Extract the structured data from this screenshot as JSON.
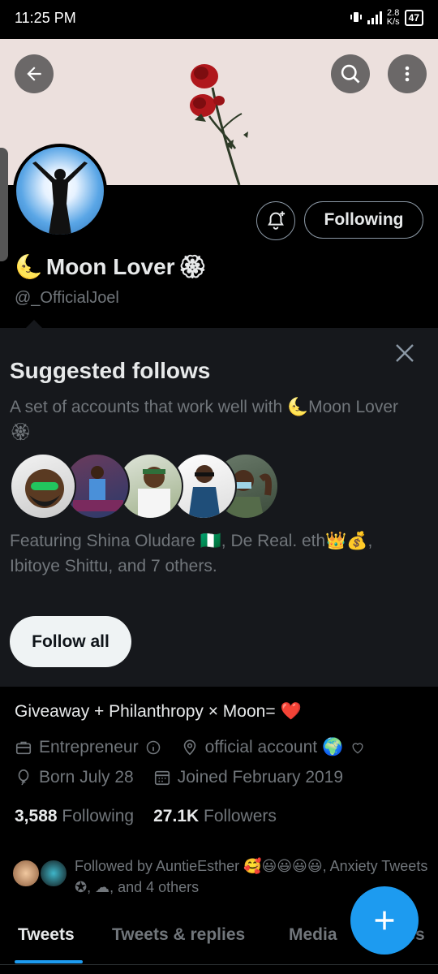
{
  "status_bar": {
    "time": "11:25 PM",
    "net_speed_value": "2.8",
    "net_speed_unit": "K/s",
    "battery": "47"
  },
  "header": {
    "icons": [
      "back-arrow-icon",
      "search-icon",
      "more-vertical-icon"
    ]
  },
  "profile": {
    "display_name": "Moon Lover",
    "name_emoji_prefix": "🌜",
    "name_emoji_suffix": "🏵",
    "handle": "@_OfficialJoel",
    "following_button": "Following"
  },
  "suggested": {
    "title": "Suggested follows",
    "description": "A set of accounts that work well with 🌜Moon Lover🏵",
    "featuring": "Featuring Shina Oludare 🇳🇬, De Real. eth👑💰, Ibitoye Shittu, and 7 others.",
    "follow_all": "Follow all"
  },
  "bio": {
    "text": "Giveaway + Philanthropy × Moon= ❤️",
    "category": "Entrepreneur",
    "location": "official account 🌍",
    "birthday": "Born July 28",
    "joined": "Joined February 2019"
  },
  "stats": {
    "following_count": "3,588",
    "following_label": "Following",
    "followers_count": "27.1K",
    "followers_label": "Followers"
  },
  "followed_by": {
    "text": "Followed by AuntieEsther 🥰😃😃😃😃, Anxiety Tweets ✪, ☁, and 4 others"
  },
  "tabs": [
    {
      "label": "Tweets"
    },
    {
      "label": "Tweets & replies"
    },
    {
      "label": "Media"
    },
    {
      "label": "Likes"
    }
  ],
  "colors": {
    "accent": "#1d9bf0",
    "background": "#000000",
    "card": "#16181c",
    "muted_text": "#71767b"
  }
}
